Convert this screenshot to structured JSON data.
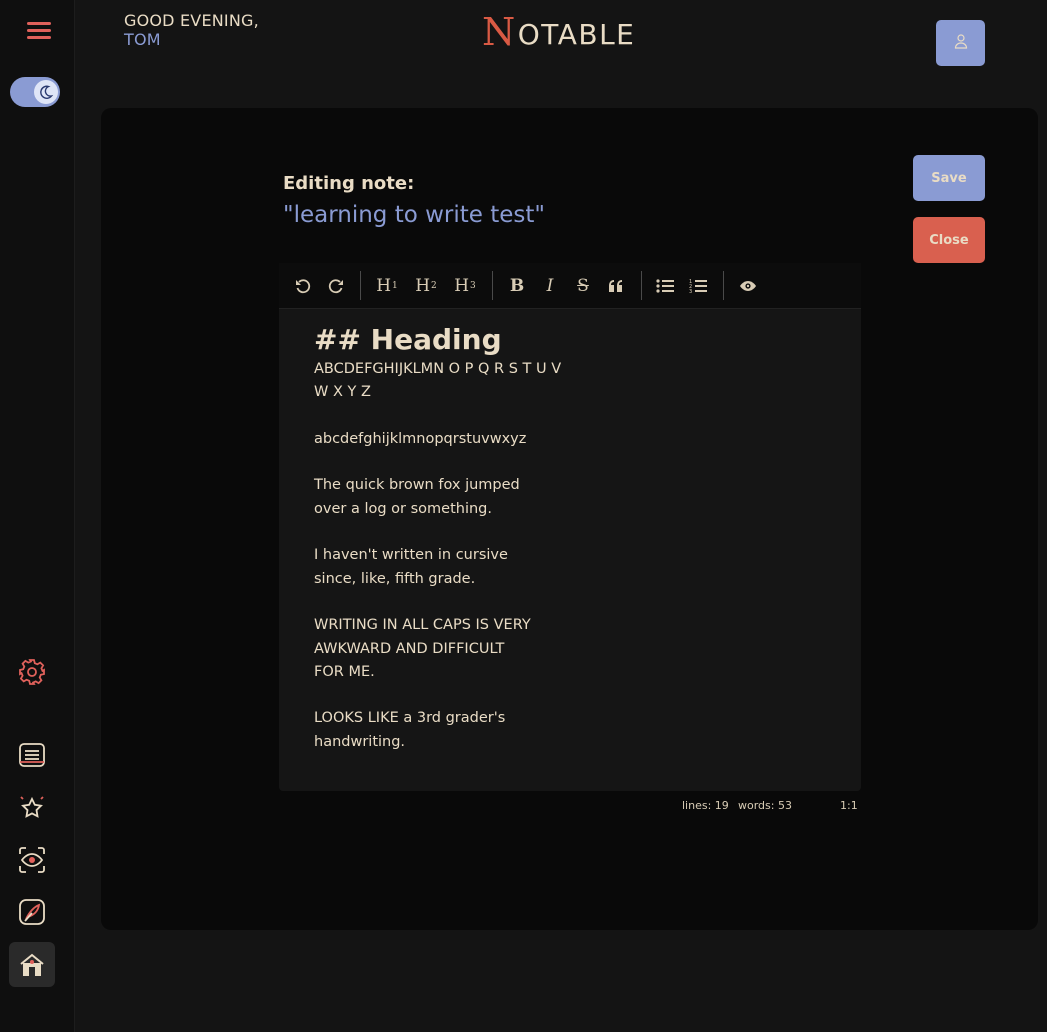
{
  "sidebar": {
    "menu_icon": "hamburger-menu-icon",
    "theme_toggle_icon": "moon-icon",
    "items": [
      {
        "name": "settings",
        "icon": "gear-icon"
      },
      {
        "name": "notes",
        "icon": "notes-icon"
      },
      {
        "name": "favorites",
        "icon": "star-icon"
      },
      {
        "name": "preview",
        "icon": "eye-icon"
      },
      {
        "name": "write",
        "icon": "feather-icon"
      },
      {
        "name": "home",
        "icon": "home-icon"
      }
    ]
  },
  "header": {
    "greeting_line1": "GOOD EVENING,",
    "greeting_name": "TOM",
    "logo_initial": "N",
    "logo_rest": "OTABLE",
    "user_icon": "user-icon"
  },
  "editor": {
    "editing_label": "Editing note:",
    "note_title": "\"learning to write test\"",
    "save_label": "Save",
    "close_label": "Close",
    "toolbar": {
      "undo_icon": "undo-icon",
      "redo_icon": "redo-icon",
      "h1": "H",
      "h1_sub": "1",
      "h2": "H",
      "h2_sub": "2",
      "h3": "H",
      "h3_sub": "3",
      "bold": "B",
      "italic": "I",
      "strike": "S",
      "quote_icon": "quote-icon",
      "ul_icon": "unordered-list-icon",
      "ol_icon": "ordered-list-icon",
      "preview_icon": "eye-icon"
    },
    "content": {
      "heading": "## Heading",
      "upper1": "ABCDEFGHIJKLMN O P Q R S T U V",
      "upper2": "W X Y Z",
      "lower": "abcdefghijklmnopqrstuvwxyz",
      "fox1": "The quick brown fox jumped",
      "fox2": "over a log or something.",
      "cursive1": "I haven't written in cursive",
      "cursive2": "since, like, fifth grade.",
      "caps1": "WRITING IN ALL CAPS IS VERY",
      "caps2": "AWKWARD AND DIFFICULT",
      "caps3": "FOR ME.",
      "grader1": "LOOKS LIKE a 3rd grader's",
      "grader2": "handwriting."
    },
    "status": {
      "lines": "lines: 19",
      "words": "words: 53",
      "cursor": "1:1"
    }
  },
  "colors": {
    "accent": "#8a9bd3",
    "danger": "#d9604f",
    "text": "#e9dcc5",
    "background": "#141414"
  }
}
